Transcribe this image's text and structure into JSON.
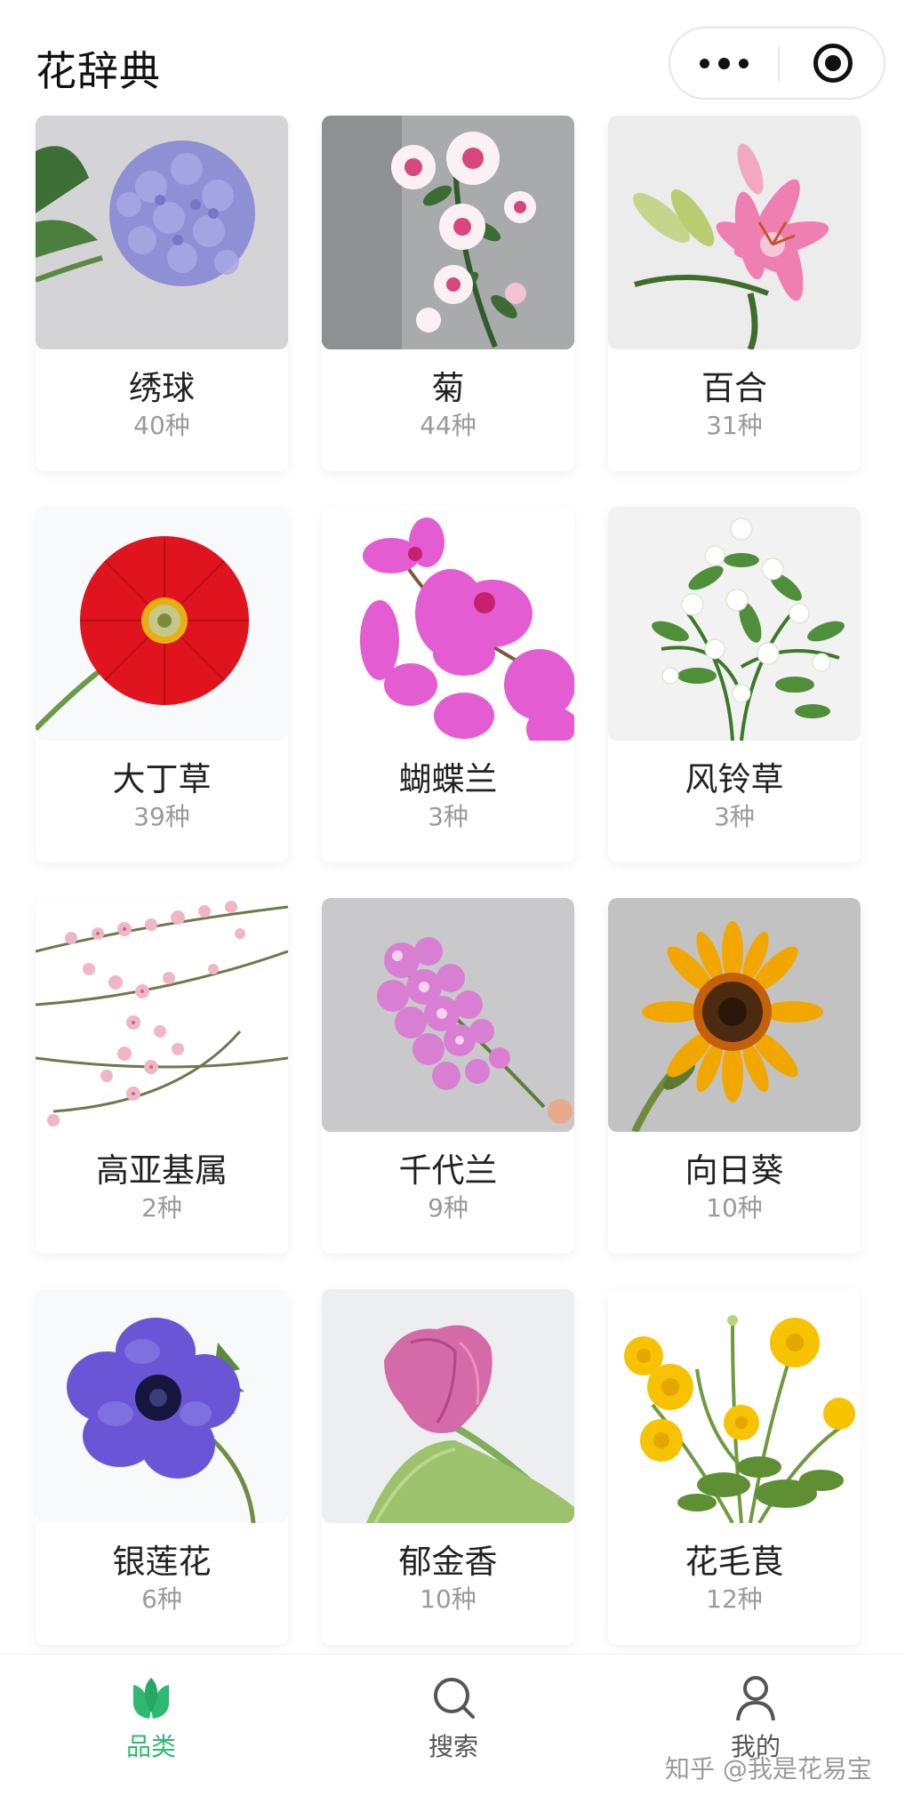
{
  "header": {
    "title": "花辞典"
  },
  "capsule": {
    "more_icon": "more-dots-icon",
    "close_icon": "target-circle-icon"
  },
  "flowers": [
    {
      "name": "绣球",
      "count": "40种",
      "color": "#8f8fd6"
    },
    {
      "name": "菊",
      "count": "44种",
      "color": "#e56a98"
    },
    {
      "name": "百合",
      "count": "31种",
      "color": "#ef7fb0"
    },
    {
      "name": "大丁草",
      "count": "39种",
      "color": "#e0141e"
    },
    {
      "name": "蝴蝶兰",
      "count": "3种",
      "color": "#e45cd2"
    },
    {
      "name": "风铃草",
      "count": "3种",
      "color": "#ffffff"
    },
    {
      "name": "高亚基属",
      "count": "2种",
      "color": "#f0b6c6"
    },
    {
      "name": "千代兰",
      "count": "9种",
      "color": "#d97fd3"
    },
    {
      "name": "向日葵",
      "count": "10种",
      "color": "#f1a700"
    },
    {
      "name": "银莲花",
      "count": "6种",
      "color": "#6a55d6"
    },
    {
      "name": "郁金香",
      "count": "10种",
      "color": "#d46aa8"
    },
    {
      "name": "花毛茛",
      "count": "12种",
      "color": "#f7c300"
    }
  ],
  "tabbar": {
    "tabs": [
      {
        "label": "品类",
        "icon": "tulip-leaf-icon",
        "active": true
      },
      {
        "label": "搜索",
        "icon": "search-icon",
        "active": false
      },
      {
        "label": "我的",
        "icon": "user-icon",
        "active": false
      }
    ]
  },
  "watermark": "知乎 @我是花易宝",
  "colors": {
    "accent": "#2eb872",
    "inactive": "#555555"
  }
}
